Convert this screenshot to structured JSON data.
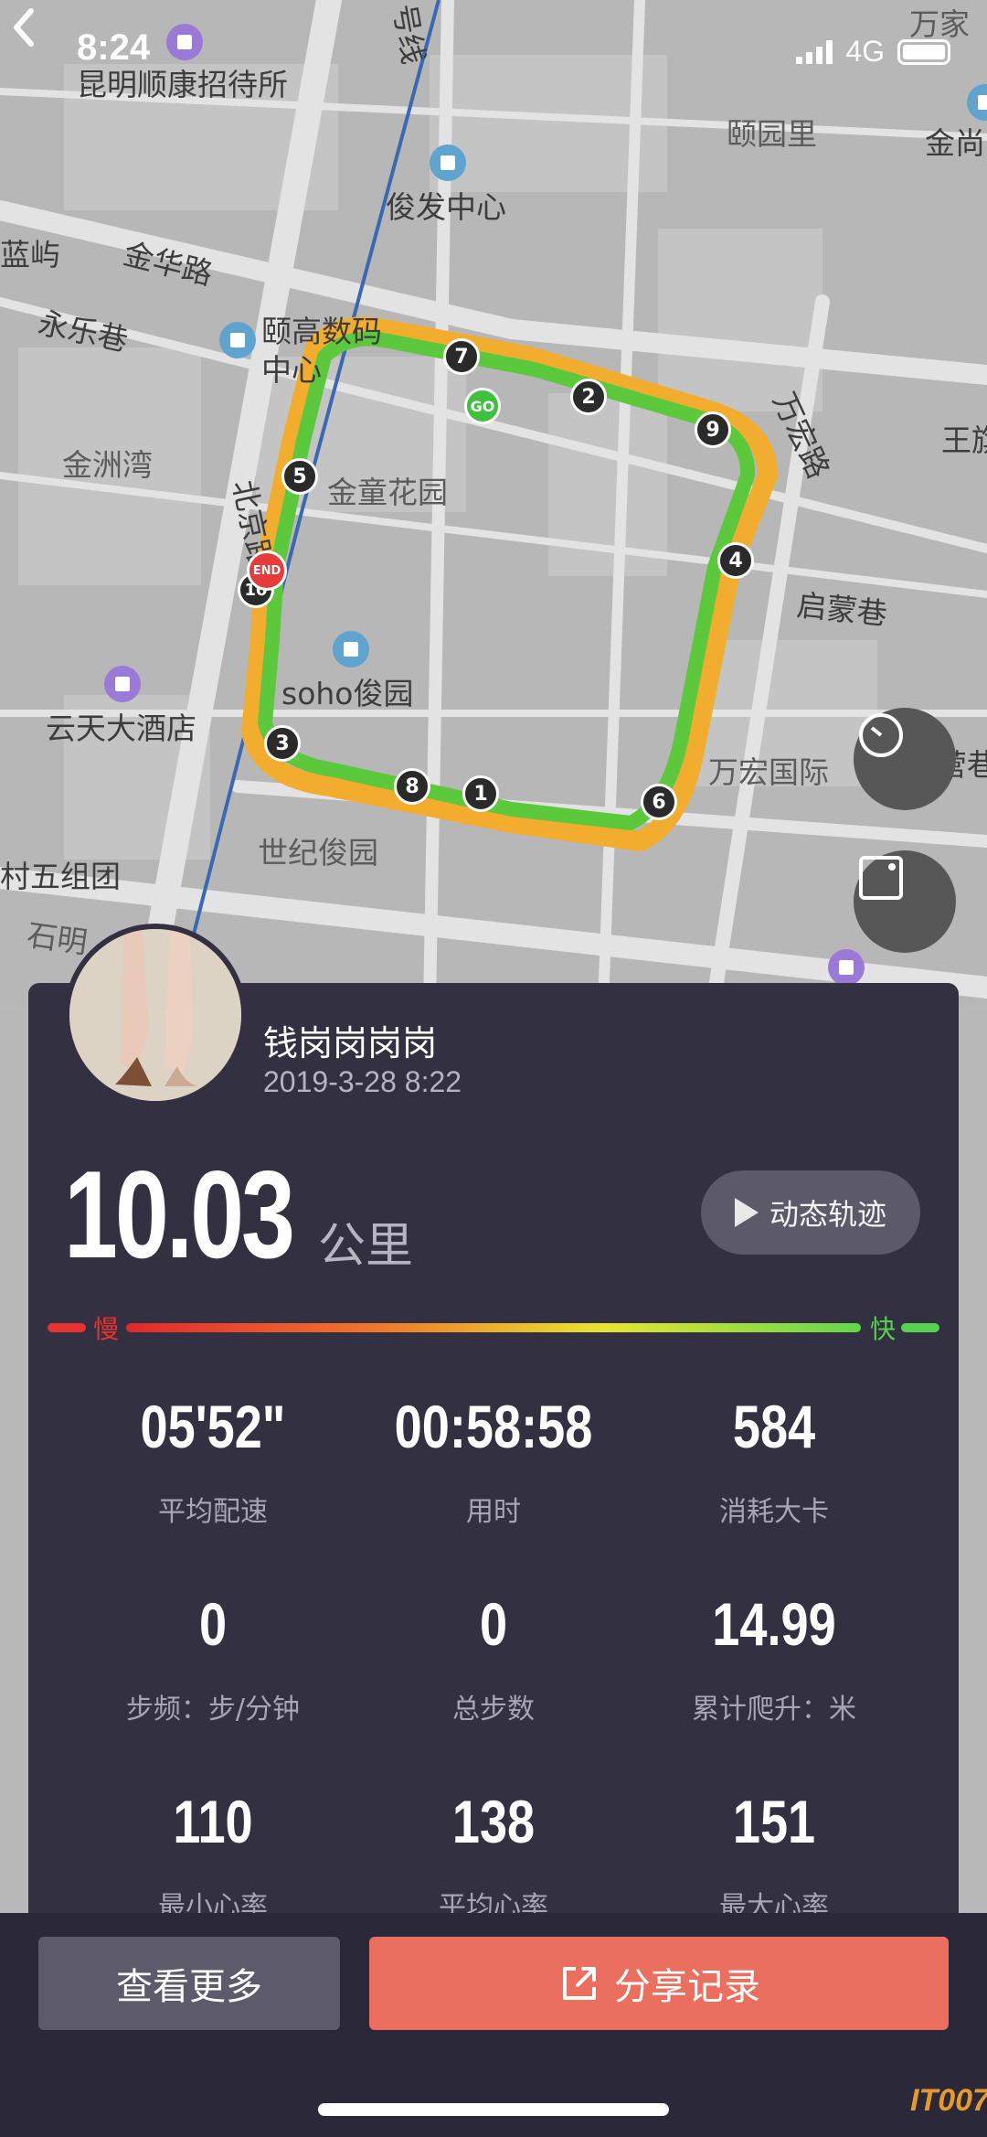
{
  "status_bar": {
    "time": "8:24",
    "network": "4G"
  },
  "map": {
    "labels": {
      "kunming": "昆明顺康招待所",
      "line_no": "号线",
      "wanjia": "万家",
      "yiyuanli": "颐园里",
      "jinshang": "金尚",
      "junfa": "俊发中心",
      "lanyu": "蓝屿",
      "jinhua": "金华路",
      "yongle": "永乐巷",
      "yigao": "颐高数码",
      "center": "中心",
      "wanhong_road": "万宏路",
      "wangqi": "王旗",
      "jinzhouwan": "金洲湾",
      "jintong": "金童花园",
      "beijing_road": "北京路",
      "qimeng": "启蒙巷",
      "soho": "soho俊园",
      "yuntian": "云天大酒店",
      "wanhong_intl": "万宏国际",
      "qiying": "旗营巷",
      "shiji": "世纪俊园",
      "cun5": "村五组团",
      "shiming": "石明"
    },
    "km_markers": [
      "1",
      "2",
      "3",
      "4",
      "5",
      "6",
      "7",
      "8",
      "9",
      "10"
    ],
    "go_label": "GO",
    "end_label": "END"
  },
  "user": {
    "name": "钱岗岗岗岗",
    "date": "2019-3-28 8:22"
  },
  "distance": {
    "value": "10.03",
    "unit": "公里"
  },
  "replay_label": "动态轨迹",
  "speed_bar": {
    "slow": "慢",
    "fast": "快"
  },
  "stats": [
    {
      "value": "05'52\"",
      "label": "平均配速"
    },
    {
      "value": "00:58:58",
      "label": "用时"
    },
    {
      "value": "584",
      "label": "消耗大卡"
    },
    {
      "value": "0",
      "label": "步频：步/分钟"
    },
    {
      "value": "0",
      "label": "总步数"
    },
    {
      "value": "14.99",
      "label": "累计爬升：米"
    },
    {
      "value": "110",
      "label": "最小心率"
    },
    {
      "value": "138",
      "label": "平均心率"
    },
    {
      "value": "151",
      "label": "最大心率"
    }
  ],
  "buttons": {
    "more": "查看更多",
    "share": "分享记录"
  },
  "watermark": "IT007",
  "colors": {
    "card": "#323041",
    "share": "#ea6f5e",
    "route_green": "#5cc93c",
    "route_orange": "#f2ac2e"
  }
}
